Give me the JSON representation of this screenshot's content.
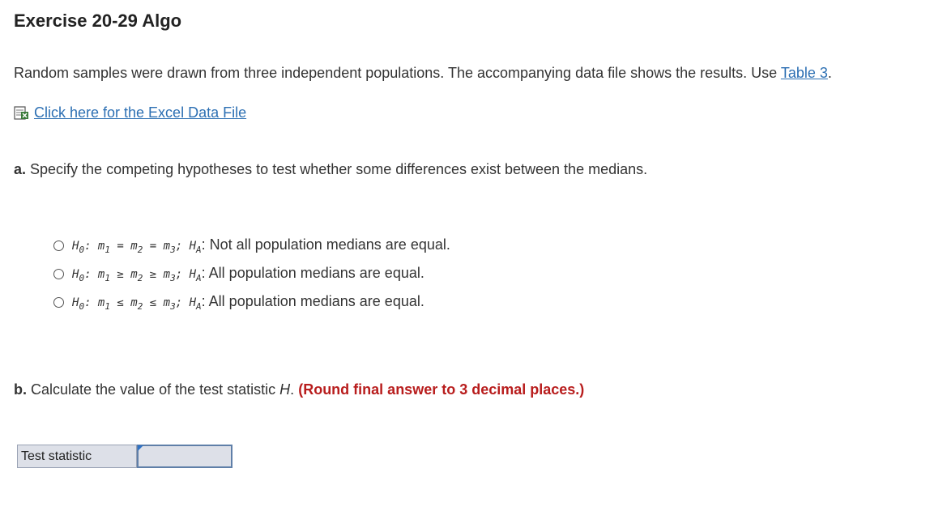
{
  "header": {
    "title": "Exercise 20-29 Algo"
  },
  "intro": {
    "text": "Random samples were drawn from three independent populations. The accompanying data file shows the results. Use ",
    "table_link": "Table 3",
    "suffix": "."
  },
  "file_link": {
    "icon": "excel-file-icon",
    "label": "Click here for the Excel Data File"
  },
  "part_a": {
    "label": "a.",
    "text": " Specify the competing hypotheses to test whether some differences exist between the medians.",
    "options": [
      {
        "h0": "H",
        "h0_sub": "0",
        "m1": "m",
        "m1_sub": "1",
        "op1": "=",
        "m2": "m",
        "m2_sub": "2",
        "op2": "=",
        "m3": "m",
        "m3_sub": "3",
        "ha": "H",
        "ha_sub": "A",
        "statement": "Not all population medians are equal."
      },
      {
        "h0": "H",
        "h0_sub": "0",
        "m1": "m",
        "m1_sub": "1",
        "op1": "≥",
        "m2": "m",
        "m2_sub": "2",
        "op2": "≥",
        "m3": "m",
        "m3_sub": "3",
        "ha": "H",
        "ha_sub": "A",
        "statement": "All population medians are equal."
      },
      {
        "h0": "H",
        "h0_sub": "0",
        "m1": "m",
        "m1_sub": "1",
        "op1": "≤",
        "m2": "m",
        "m2_sub": "2",
        "op2": "≤",
        "m3": "m",
        "m3_sub": "3",
        "ha": "H",
        "ha_sub": "A",
        "statement": "All population medians are equal."
      }
    ]
  },
  "part_b": {
    "label": "b.",
    "text": " Calculate the value of the test statistic ",
    "var": "H",
    "period": ".",
    "instruction": "(Round final answer to 3 decimal places.)"
  },
  "answer": {
    "label": "Test statistic",
    "value": ""
  },
  "colors": {
    "link": "#2c6fb3",
    "instruction_red": "#b81d1d",
    "input_bg": "#dde0e8",
    "input_border": "#5f7fa8"
  }
}
